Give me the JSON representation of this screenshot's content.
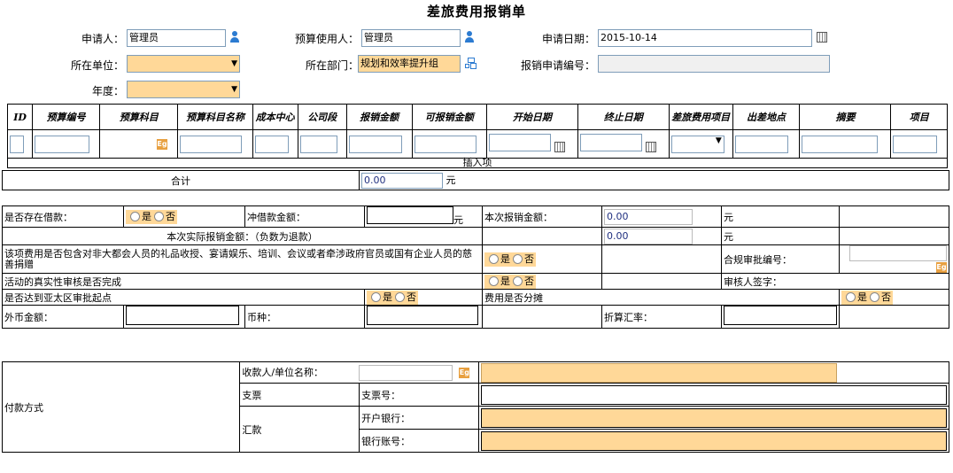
{
  "title": "差旅费用报销单",
  "top": {
    "applicant_label": "申请人：",
    "applicant_value": "管理员",
    "budget_user_label": "预算使用人：",
    "budget_user_value": "管理员",
    "apply_date_label": "申请日期：",
    "apply_date_value": "2015-10-14",
    "unit_label": "所在单位：",
    "dept_label": "所在部门：",
    "dept_value": "规划和效率提升组",
    "apply_no_label": "报销申请编号：",
    "year_label": "年度："
  },
  "detail": {
    "headers": [
      "ID",
      "预算编号",
      "预算科目",
      "预算科目名称",
      "成本中心",
      "公司段",
      "报销金额",
      "可报销金额",
      "开始日期",
      "终止日期",
      "差旅费用项目",
      "出差地点",
      "摘要",
      "项目"
    ],
    "insert_label": "插入项",
    "total_label": "合计",
    "total_value": "0.00",
    "yuan": "元"
  },
  "summary": {
    "has_loan_label": "是否存在借款：",
    "yes": "是",
    "no": "否",
    "offset_label": "冲借款金额：",
    "yuan": "元",
    "this_amount_label": "本次报销金额：",
    "this_amount_value": "0.00",
    "actual_label": "本次实际报销金额：（负数为退款）",
    "actual_value": "0.00",
    "gift_label": "该项费用是否包含对非大都会人员的礼品收授、宴请娱乐、培训、会议或者牵涉政府官员或国有企业人员的慈善捐赠",
    "compliance_no_label": "合规审批编号：",
    "authenticity_label": "活动的真实性审核是否完成",
    "reviewer_label": "审核人签字：",
    "apac_label": "是否达到亚太区审批起点",
    "share_label": "费用是否分摊",
    "fx_amount_label": "外币金额：",
    "currency_label": "币种：",
    "rate_label": "折算汇率："
  },
  "payment": {
    "method_label": "付款方式",
    "payee_label": "收款人/单位名称：",
    "check_label": "支票",
    "check_no_label": "支票号：",
    "remit_label": "汇款",
    "bank_label": "开户银行：",
    "account_label": "银行账号："
  }
}
